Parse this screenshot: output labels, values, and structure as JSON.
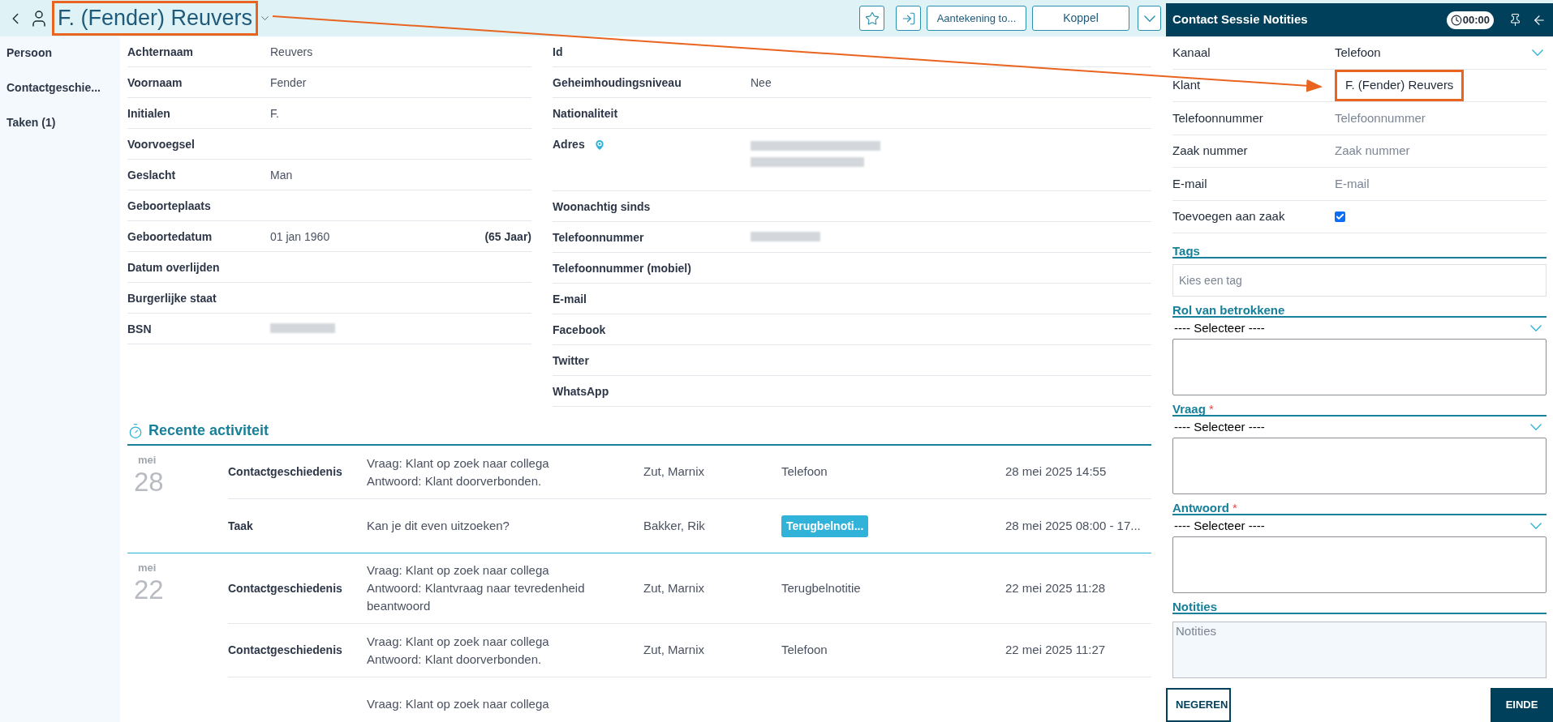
{
  "header": {
    "title": "F. (Fender) Reuvers",
    "title_highlighted": true,
    "buttons": [
      "Aantekening to...",
      "Koppel"
    ]
  },
  "sidebar": {
    "items": [
      {
        "label": "Persoon"
      },
      {
        "label": "Contactgeschie..."
      },
      {
        "label": "Taken (1)"
      }
    ]
  },
  "person": {
    "left": [
      {
        "label": "Achternaam",
        "kind": "text",
        "value": "Reuvers"
      },
      {
        "label": "Voornaam",
        "kind": "text",
        "value": "Fender"
      },
      {
        "label": "Initialen",
        "kind": "text",
        "value": "F."
      },
      {
        "label": "Voorvoegsel",
        "kind": "text"
      },
      {
        "label": "Geslacht",
        "kind": "text",
        "value": "Man"
      },
      {
        "label": "Geboorteplaats",
        "kind": "text"
      },
      {
        "label": "Geboortedatum",
        "kind": "text",
        "value": "01 jan 1960",
        "extra": "(65 Jaar)"
      },
      {
        "label": "Datum overlijden",
        "kind": "text"
      },
      {
        "label": "Burgerlijke staat",
        "kind": "text"
      },
      {
        "label": "BSN",
        "kind": "redacted"
      }
    ],
    "right": [
      {
        "label": "Id",
        "kind": "text"
      },
      {
        "label": "Geheimhoudingsniveau",
        "kind": "text",
        "value": "Nee"
      },
      {
        "label": "Nationaliteit",
        "kind": "text"
      },
      {
        "label": "Adres",
        "kind": "redacted_address",
        "location_icon": true
      },
      {
        "label": "Woonachtig sinds",
        "kind": "text"
      },
      {
        "label": "Telefoonnummer",
        "kind": "redacted_phone"
      },
      {
        "label": "Telefoonnummer (mobiel)",
        "kind": "text"
      },
      {
        "label": "E-mail",
        "kind": "text"
      },
      {
        "label": "Facebook",
        "kind": "text"
      },
      {
        "label": "Twitter",
        "kind": "text"
      },
      {
        "label": "WhatsApp",
        "kind": "text"
      }
    ]
  },
  "activity": {
    "title": "Recente activiteit",
    "groups": [
      {
        "month": "mei",
        "day": "28",
        "items": [
          {
            "type": "Contactgeschiedenis",
            "lines": [
              "Vraag: Klant op zoek naar collega",
              "Antwoord: Klant doorverbonden."
            ],
            "person": "Zut, Marnix",
            "channel": "Telefoon",
            "channel_badge": false,
            "datetime": "28 mei 2025 14:55"
          },
          {
            "type": "Taak",
            "lines": [
              "Kan je dit even uitzoeken?"
            ],
            "person": "Bakker, Rik",
            "channel": "Terugbelnoti...",
            "channel_badge": true,
            "datetime": "28 mei 2025 08:00 - 17..."
          }
        ]
      },
      {
        "month": "mei",
        "day": "22",
        "items": [
          {
            "type": "Contactgeschiedenis",
            "lines": [
              "Vraag: Klant op zoek naar collega",
              "Antwoord: Klantvraag naar tevredenheid beantwoord"
            ],
            "person": "Zut, Marnix",
            "channel": "Terugbelnotitie",
            "channel_badge": false,
            "datetime": "22 mei 2025 11:28"
          },
          {
            "type": "Contactgeschiedenis",
            "lines": [
              "Vraag: Klant op zoek naar collega",
              "Antwoord: Klant doorverbonden."
            ],
            "person": "Zut, Marnix",
            "channel": "Telefoon",
            "channel_badge": false,
            "datetime": "22 mei 2025 11:27"
          },
          {
            "lines": [
              "Vraag: Klant op zoek naar collega"
            ]
          }
        ]
      }
    ]
  },
  "panel": {
    "title": "Contact Sessie Notities",
    "timer": "00:00",
    "fields": [
      {
        "label": "Kanaal",
        "kind": "select",
        "value": "Telefoon"
      },
      {
        "label": "Klant",
        "kind": "text",
        "value": "F. (Fender)  Reuvers",
        "highlighted": true
      },
      {
        "label": "Telefoonnummer",
        "kind": "input",
        "placeholder": "Telefoonnummer"
      },
      {
        "label": "Zaak nummer",
        "kind": "input",
        "placeholder": "Zaak nummer"
      },
      {
        "label": "E-mail",
        "kind": "input",
        "placeholder": "E-mail"
      },
      {
        "label": "Toevoegen aan zaak",
        "kind": "checkbox",
        "checked": true
      }
    ],
    "sections": [
      {
        "title": "Tags",
        "kind": "tags",
        "placeholder": "Kies een tag"
      },
      {
        "title": "Rol van betrokkene",
        "kind": "select",
        "value": "---- Selecteer ----"
      },
      {
        "title": "Vraag",
        "kind": "select",
        "required_mark": "*",
        "value": "---- Selecteer ----"
      },
      {
        "title": "Antwoord",
        "kind": "select",
        "required_mark": "*",
        "value": "---- Selecteer ----"
      },
      {
        "title": "Notities",
        "kind": "notes",
        "placeholder": "Notities"
      }
    ],
    "buttons": [
      {
        "label": "NEGEREN",
        "kind": "secondary"
      },
      {
        "label": "EINDE",
        "kind": "primary"
      }
    ]
  },
  "annotation": {
    "arrow": true
  }
}
